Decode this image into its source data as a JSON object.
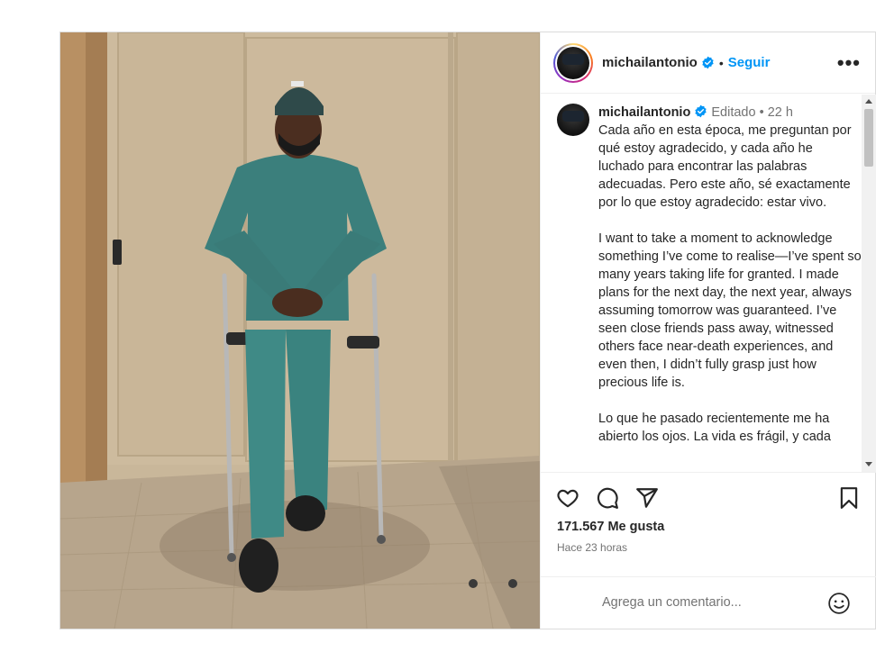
{
  "post": {
    "photo_alt": "photo",
    "header": {
      "username": "michailantonio",
      "separator": "•",
      "follow_label": "Seguir",
      "more_label": "•••"
    },
    "caption": {
      "username": "michailantonio",
      "edited": "Editado",
      "separator": "•",
      "time": "22 h",
      "paragraphs": [
        "Cada año en esta época, me preguntan por qué estoy agradecido, y cada año he luchado para encontrar las palabras adecuadas. Pero este año, sé exactamente por lo que estoy agradecido: estar vivo.",
        "I want to take a moment to acknowledge something I’ve come to realise—I’ve spent so many years taking life for granted. I made plans for the next day, the next year, always assuming tomorrow was guaranteed. I’ve seen close friends pass away, witnessed others face near-death experiences, and even then, I didn’t fully grasp just how precious life is.",
        "Lo que he pasado recientemente me ha abierto los ojos. La vida es frágil, y cada"
      ]
    },
    "actions": {
      "like_icon": "heart-icon",
      "comment_icon": "comment-icon",
      "share_icon": "share-icon",
      "save_icon": "bookmark-icon"
    },
    "likes": "171.567 Me gusta",
    "posted_ago": "Hace 23 horas",
    "comment": {
      "placeholder": "Agrega un comentario...",
      "emoji_icon": "smiley-icon"
    },
    "colors": {
      "accent": "#0095f6",
      "text": "#262626",
      "muted": "#737373",
      "border": "#dbdbdb"
    }
  }
}
